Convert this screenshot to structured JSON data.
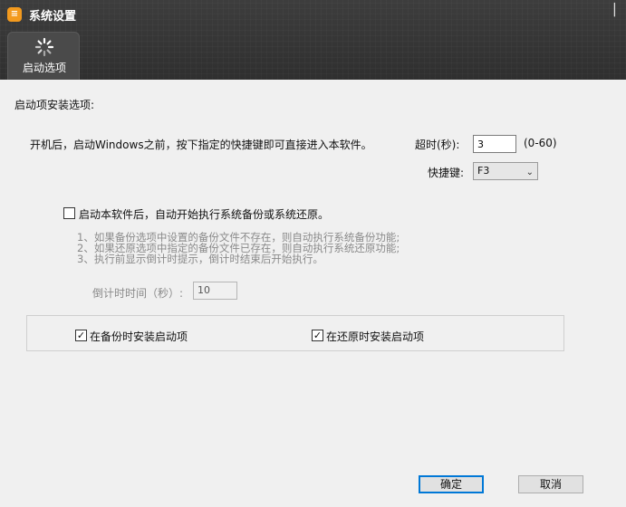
{
  "window": {
    "title": "系统设置",
    "logo_text": "≡",
    "close_glyph": "▕"
  },
  "tab": {
    "label": "启动选项"
  },
  "settings": {
    "section_title": "启动项安装选项:",
    "description": "开机后，启动Windows之前，按下指定的快捷键即可直接进入本软件。",
    "timeout_label": "超时(秒):",
    "timeout_value": "3",
    "timeout_range": "(0-60)",
    "shortcut_label": "快捷键:",
    "shortcut_value": "F3",
    "autorun_label": "启动本软件后，自动开始执行系统备份或系统还原。",
    "autorun_checked": false,
    "notes": [
      "1、如果备份选项中设置的备份文件不存在，则自动执行系统备份功能;",
      "2、如果还原选项中指定的备份文件已存在，则自动执行系统还原功能;",
      "3、执行前显示倒计时提示，倒计时结束后开始执行。"
    ],
    "countdown_label": "倒计时时间（秒）:",
    "countdown_value": "10",
    "install_on_backup_label": "在备份时安装启动项",
    "install_on_backup_checked": true,
    "install_on_restore_label": "在还原时安装启动项",
    "install_on_restore_checked": true
  },
  "buttons": {
    "ok": "确定",
    "cancel": "取消"
  },
  "colors": {
    "header": "#333333",
    "logo": "#f39a1e",
    "focus": "#0078d7"
  }
}
